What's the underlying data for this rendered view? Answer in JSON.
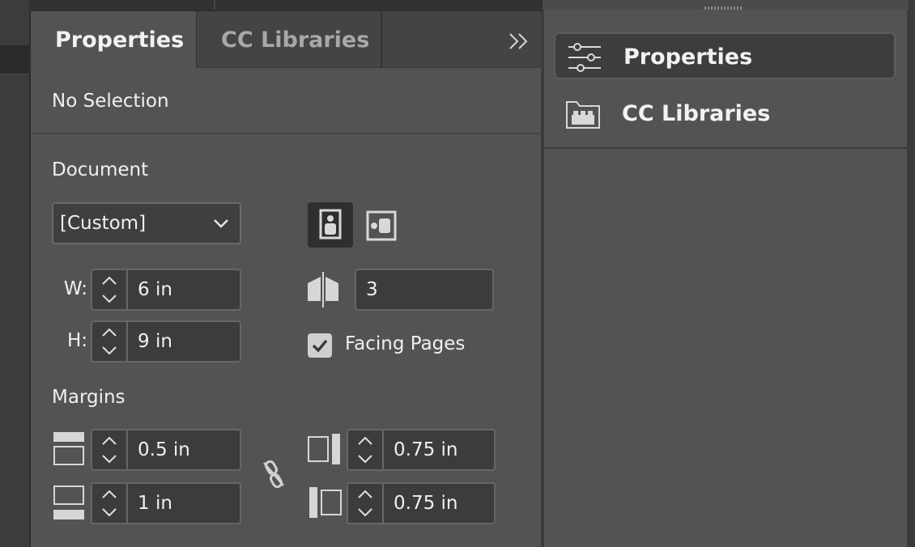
{
  "panel": {
    "tabs": [
      {
        "label": "Properties",
        "active": true
      },
      {
        "label": "CC Libraries",
        "active": false
      }
    ],
    "collapse_icon": "double-chevron-right-icon",
    "selection_status": "No Selection",
    "document": {
      "heading": "Document",
      "preset": "[Custom]",
      "width_label": "W:",
      "width_value": "6 in",
      "height_label": "H:",
      "height_value": "9 in",
      "orientation": "portrait",
      "pages_value": "3",
      "facing_pages_label": "Facing Pages",
      "facing_pages_checked": true
    },
    "margins": {
      "heading": "Margins",
      "top_value": "0.5 in",
      "bottom_value": "1 in",
      "inside_value": "0.75 in",
      "outside_value": "0.75 in",
      "link_icon": "unlink-chain-icon"
    }
  },
  "dock": {
    "items": [
      {
        "label": "Properties",
        "icon": "sliders-icon",
        "selected": true
      },
      {
        "label": "CC Libraries",
        "icon": "library-folder-icon",
        "selected": false
      }
    ]
  },
  "colors": {
    "panel_bg": "#535353",
    "tabbar_bg": "#444444",
    "field_bg": "#3c3c3c",
    "text": "#f0f0f0"
  }
}
